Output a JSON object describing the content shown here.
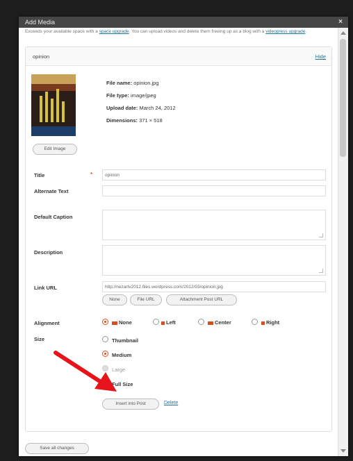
{
  "window": {
    "title": "Add Media",
    "close_symbol": "×"
  },
  "notice": {
    "text": "Exceeds your available space with a",
    "link_upgrade": "space upgrade",
    "text2": "You can upload videos and delete them freeing up as a blog with a",
    "link_video": "videopress upgrade"
  },
  "item": {
    "filename": "opinion",
    "hide_label": "Hide",
    "file_name_label": "File name:",
    "file_name_value": "opinion.jpg",
    "file_type_label": "File type:",
    "file_type_value": "image/jpeg",
    "upload_date_label": "Upload date:",
    "upload_date_value": "March 24, 2012",
    "dimensions_label": "Dimensions:",
    "dimensions_value": "371 × 518",
    "edit_image_label": "Edit Image"
  },
  "fields": {
    "title_label": "Title",
    "title_required": "*",
    "title_value": "opinion",
    "alt_label": "Alternate Text",
    "alt_value": "",
    "caption_label": "Default Caption",
    "caption_value": "",
    "description_label": "Description",
    "description_value": "",
    "link_label": "Link URL",
    "link_value": "http://nezartv2012.files.wordpress.com/2012/03/opinion.jpg",
    "link_buttons": [
      "None",
      "File URL",
      "Attachment Post URL"
    ]
  },
  "alignment": {
    "label": "Alignment",
    "options": [
      "None",
      "Left",
      "Center",
      "Right"
    ],
    "selected": "None"
  },
  "size": {
    "label": "Size",
    "options": [
      "Thumbnail",
      "Medium",
      "Large",
      "Full Size"
    ],
    "selected": "Medium",
    "disabled": [
      "Large"
    ]
  },
  "actions": {
    "insert_label": "Insert into Post",
    "delete_label": "Delete",
    "save_all_label": "Save all changes"
  },
  "colors": {
    "accent": "#d54e21",
    "link": "#21759b",
    "annotation_arrow": "#e8141b"
  }
}
